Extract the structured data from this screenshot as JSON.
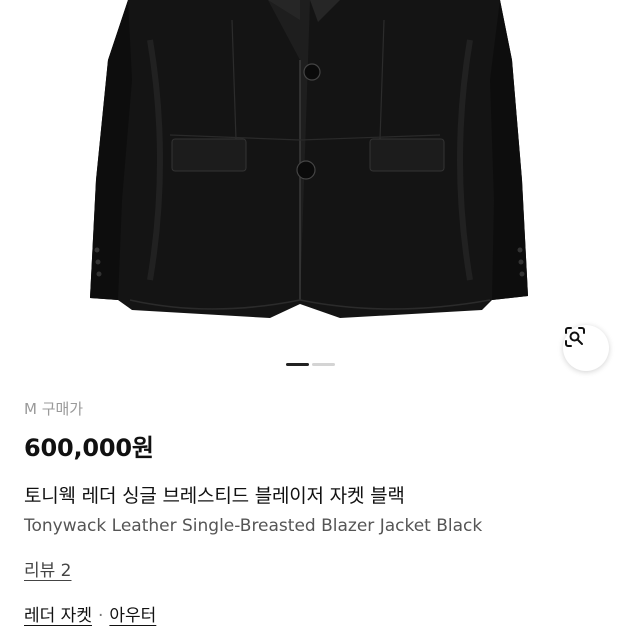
{
  "product_image": {
    "alt": "",
    "carousel": {
      "total": 2,
      "active": 1
    }
  },
  "lens_button": {
    "icon": "visual-search-icon"
  },
  "price": {
    "label": "M 구매가",
    "value": "600,000원"
  },
  "title": {
    "korean": "토니웩 레더 싱글 브레스티드 블레이저 자켓 블랙",
    "english": "Tonywack Leather Single-Breasted Blazer Jacket Black"
  },
  "review": {
    "label": "리뷰 2"
  },
  "categories": {
    "items": [
      "레더 자켓",
      "아우터"
    ],
    "separator": "·"
  },
  "colors": {
    "jacket": "#151515",
    "text_primary": "#111111",
    "text_secondary": "#555555",
    "muted": "#9a9a9a"
  }
}
